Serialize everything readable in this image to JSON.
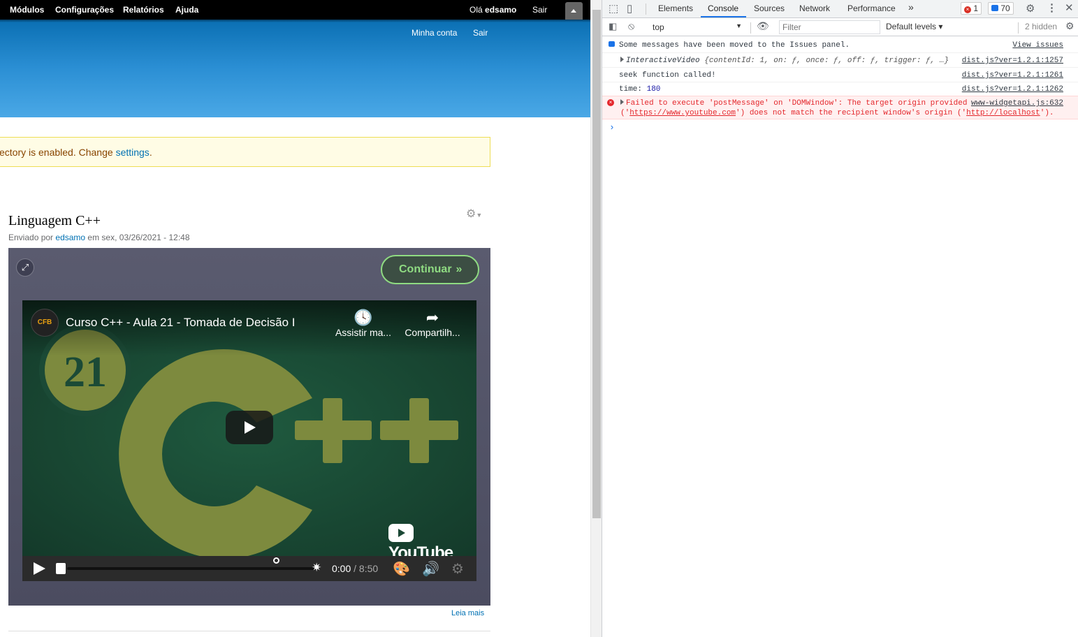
{
  "toolbar": {
    "modules": "Módulos",
    "config": "Configurações",
    "reports": "Relatórios",
    "help": "Ajuda",
    "hello": "Olá",
    "username": "edsamo",
    "logout": "Sair"
  },
  "header": {
    "my_account": "Minha conta",
    "logout": "Sair"
  },
  "message": {
    "text": "ectory is enabled. Change ",
    "link": "settings",
    "end": "."
  },
  "node": {
    "title": "Linguagem C++",
    "submitted_prefix": "Enviado por ",
    "author": "edsamo",
    "submitted_suffix": " em sex, 03/26/2021 - 12:48",
    "read_more": "Leia mais"
  },
  "video": {
    "continue_label": "Continuar",
    "yt_title": "Curso C++ - Aula 21 - Tomada de Decisão I",
    "channel_logo_text": "CFB",
    "watch_later": "Assistir ma...",
    "share": "Compartilh...",
    "thumbnail_number": "21",
    "thumbnail_text": "C++",
    "brand": "YouTube",
    "time_current": "0:00",
    "time_separator": " / ",
    "time_duration": "8:50"
  },
  "devtools": {
    "tabs": [
      "Elements",
      "Console",
      "Sources",
      "Network",
      "Performance"
    ],
    "more_tabs": "»",
    "error_count": "1",
    "message_count": "70",
    "context": "top",
    "filter_placeholder": "Filter",
    "levels": "Default levels ▾",
    "hidden": "2 hidden",
    "logs": {
      "issues_msg": "Some messages have been moved to the Issues panel.",
      "issues_link": "View issues",
      "iv_name": "InteractiveVideo",
      "iv_obj": " {contentId: 1, on: ƒ, once: ƒ, off: ƒ, trigger: ƒ, …}",
      "iv_src": "dist.js?ver=1.2.1:1257",
      "seek_msg": "seek function called!",
      "seek_src": "dist.js?ver=1.2.1:1261",
      "time_label": "time: ",
      "time_value": "180",
      "time_src": "dist.js?ver=1.2.1:1262",
      "err_line1": "Failed to execute 'postMessage' on 'DOMWindow': The target origin provided",
      "err_src": "www-widgetapi.js:632",
      "err_line2_a": "('",
      "err_url1": "https://www.youtube.com",
      "err_line2_b": "') does not match the recipient window's origin ('",
      "err_url2": "http://localhost",
      "err_line2_c": "')."
    }
  },
  "colors": {
    "header_blue": "#2b8fd4",
    "video_bg": "#1a4734",
    "cpp_olive": "#7d8a3e",
    "continue_green": "#8fdb82",
    "console_blue": "#1a73e8",
    "error_red": "#e4272c"
  }
}
